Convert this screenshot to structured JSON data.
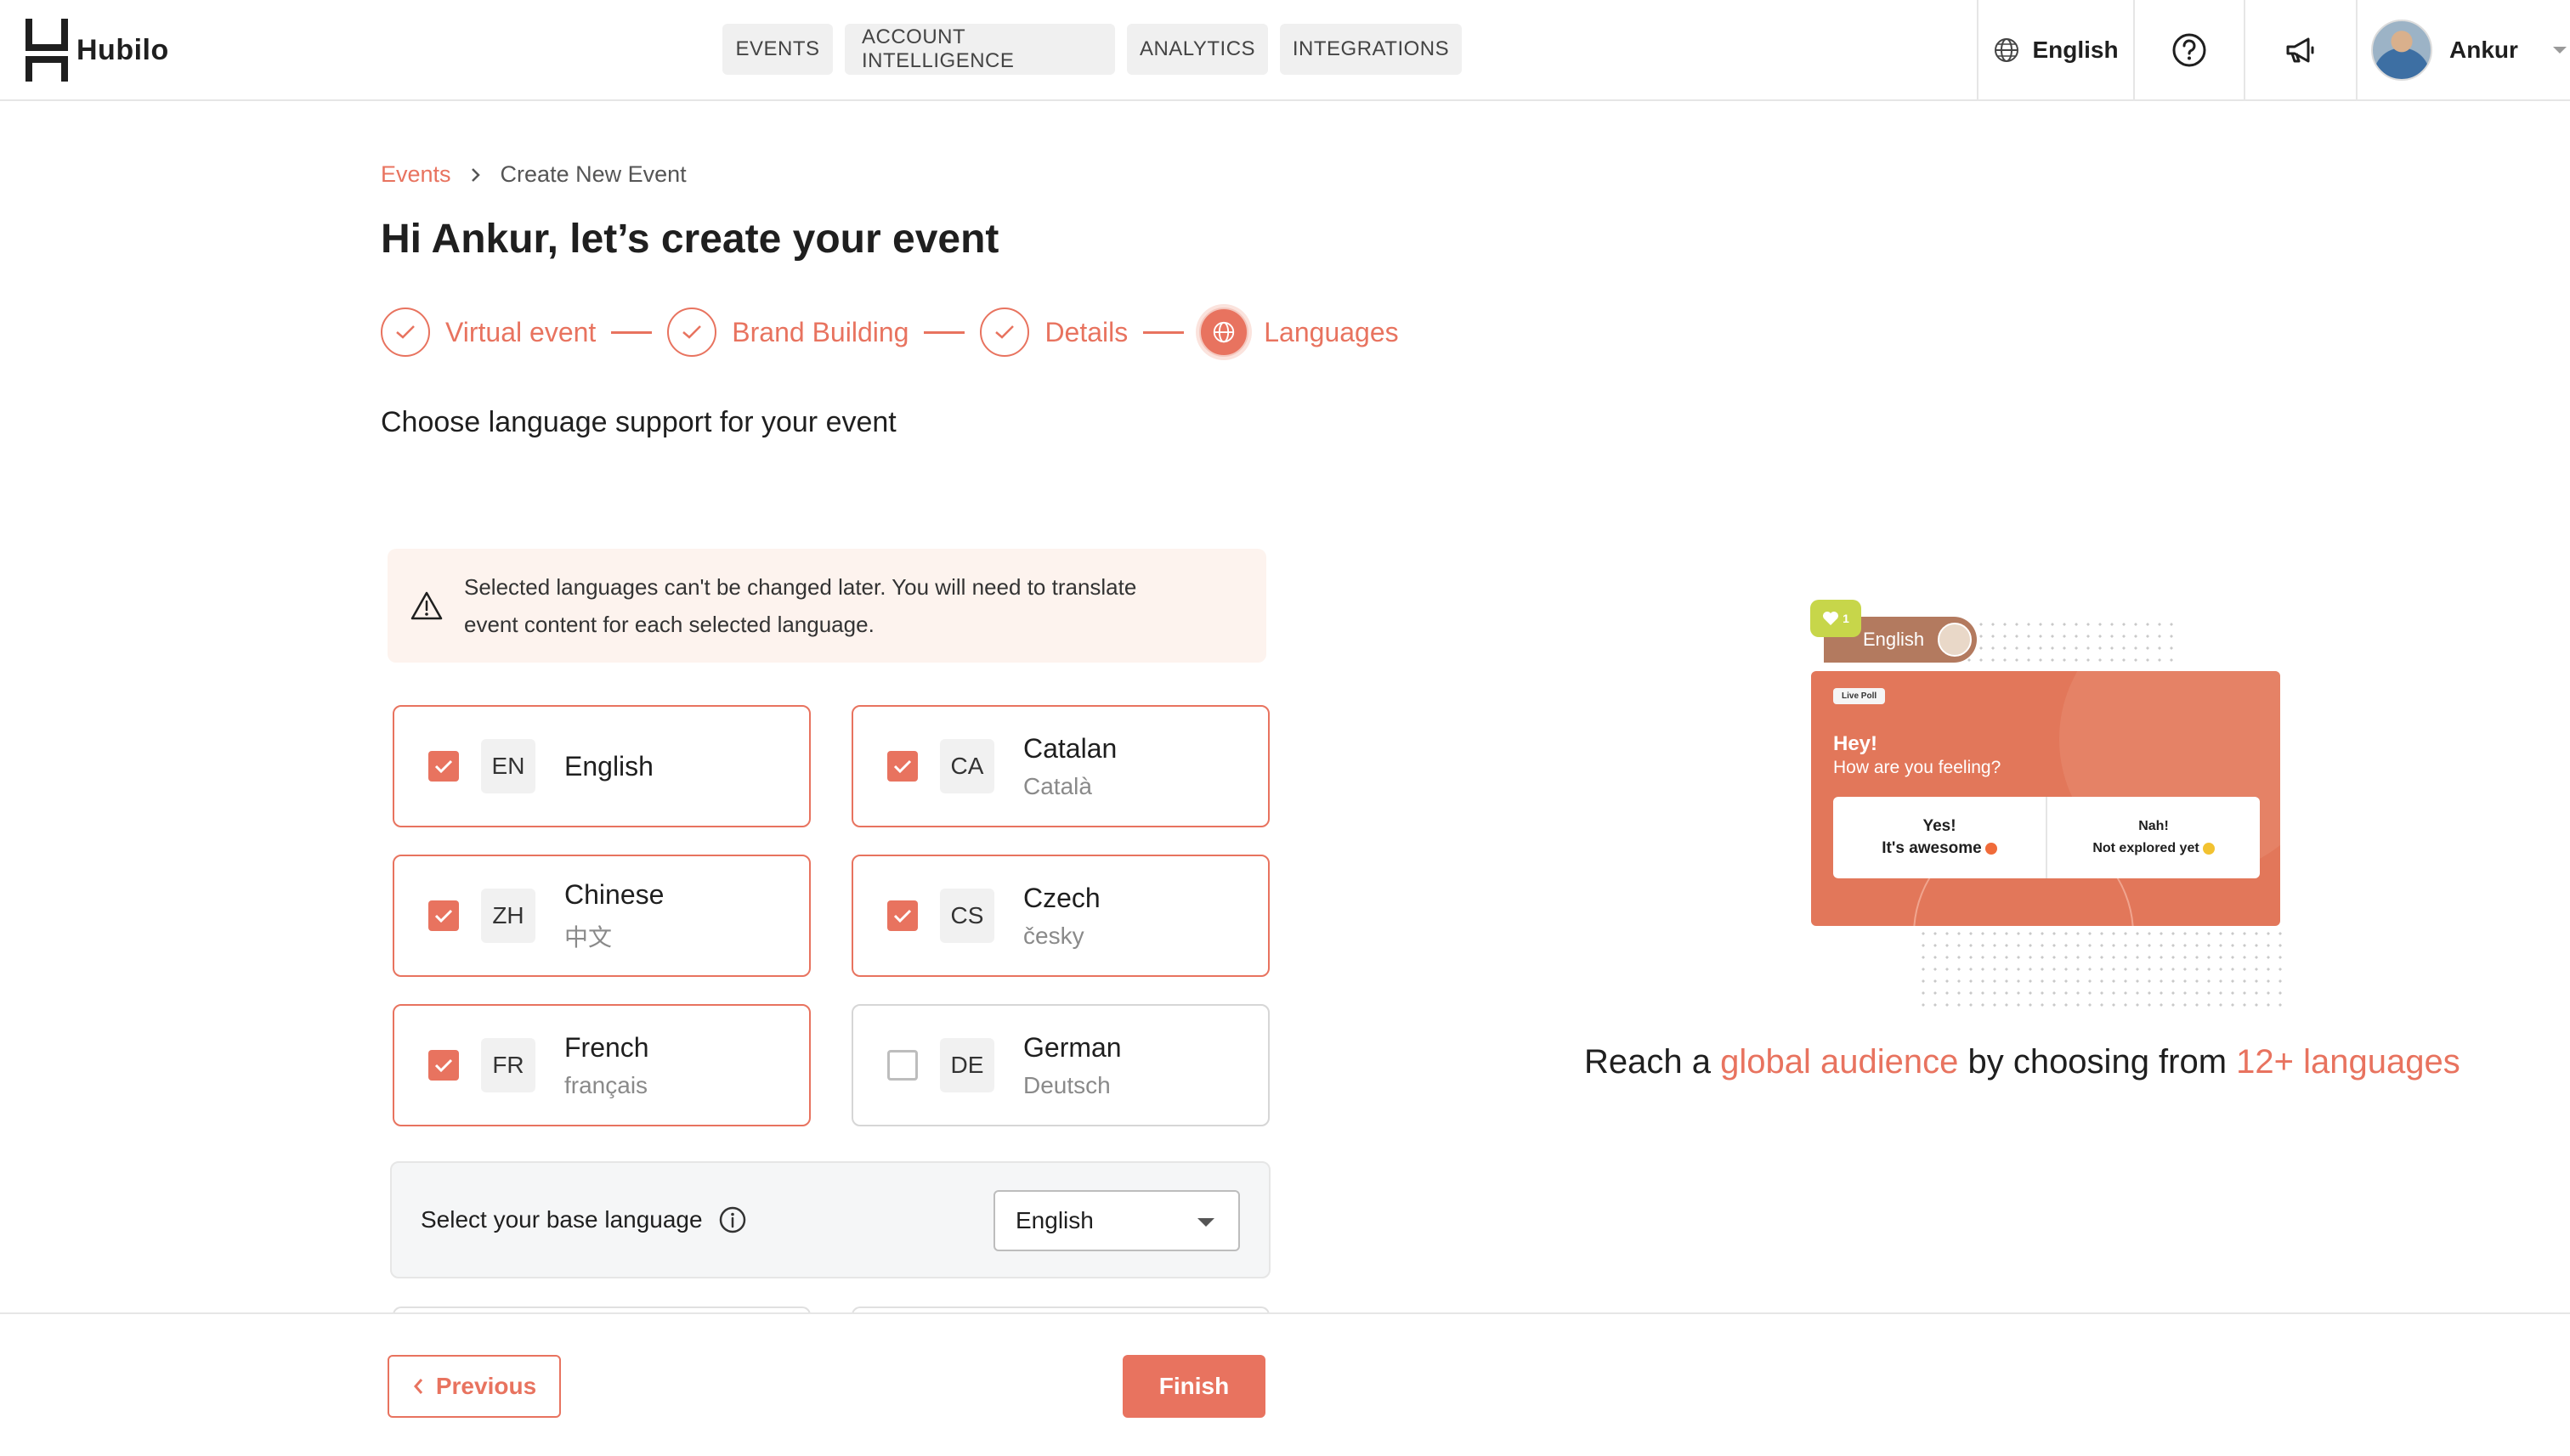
{
  "brand": {
    "name": "Hubilo",
    "accent": "#e8735f"
  },
  "nav": {
    "items": [
      "EVENTS",
      "ACCOUNT INTELLIGENCE",
      "ANALYTICS",
      "INTEGRATIONS"
    ]
  },
  "header_right": {
    "language": "English",
    "help_icon": "help-circle-icon",
    "announce_icon": "megaphone-icon",
    "user_name": "Ankur"
  },
  "breadcrumb": {
    "link": "Events",
    "current": "Create New Event"
  },
  "page_title": "Hi Ankur, let’s create your event",
  "steps": [
    {
      "label": "Virtual event",
      "state": "done"
    },
    {
      "label": "Brand Building",
      "state": "done"
    },
    {
      "label": "Details",
      "state": "done"
    },
    {
      "label": "Languages",
      "state": "active"
    }
  ],
  "subtitle": "Choose language support for your event",
  "warning": {
    "line1": "Selected languages can't be changed later. You will need to translate",
    "line2": "event content for each selected language."
  },
  "languages": [
    {
      "code": "EN",
      "name": "English",
      "native": "",
      "checked": true
    },
    {
      "code": "CA",
      "name": "Catalan",
      "native": "Català",
      "checked": true
    },
    {
      "code": "ZH",
      "name": "Chinese",
      "native": "中文",
      "checked": true
    },
    {
      "code": "CS",
      "name": "Czech",
      "native": "česky",
      "checked": true
    },
    {
      "code": "FR",
      "name": "French",
      "native": "français",
      "checked": true
    },
    {
      "code": "DE",
      "name": "German",
      "native": "Deutsch",
      "checked": false
    }
  ],
  "base_language": {
    "label": "Select your base language",
    "selected": "English"
  },
  "footer": {
    "previous": "Previous",
    "finish": "Finish"
  },
  "illustration": {
    "badge_count": "1",
    "pill_language": "English",
    "live_poll": "Live Poll",
    "hey": "Hey!",
    "question": "How are you feeling?",
    "option1_line1": "Yes!",
    "option1_line2": "It's awesome",
    "option2_line1": "Nah!",
    "option2_line2": "Not explored yet"
  },
  "tagline": {
    "part1": "Reach a ",
    "hl1": "global audience",
    "part2": " by choosing from ",
    "hl2": "12+ languages"
  }
}
